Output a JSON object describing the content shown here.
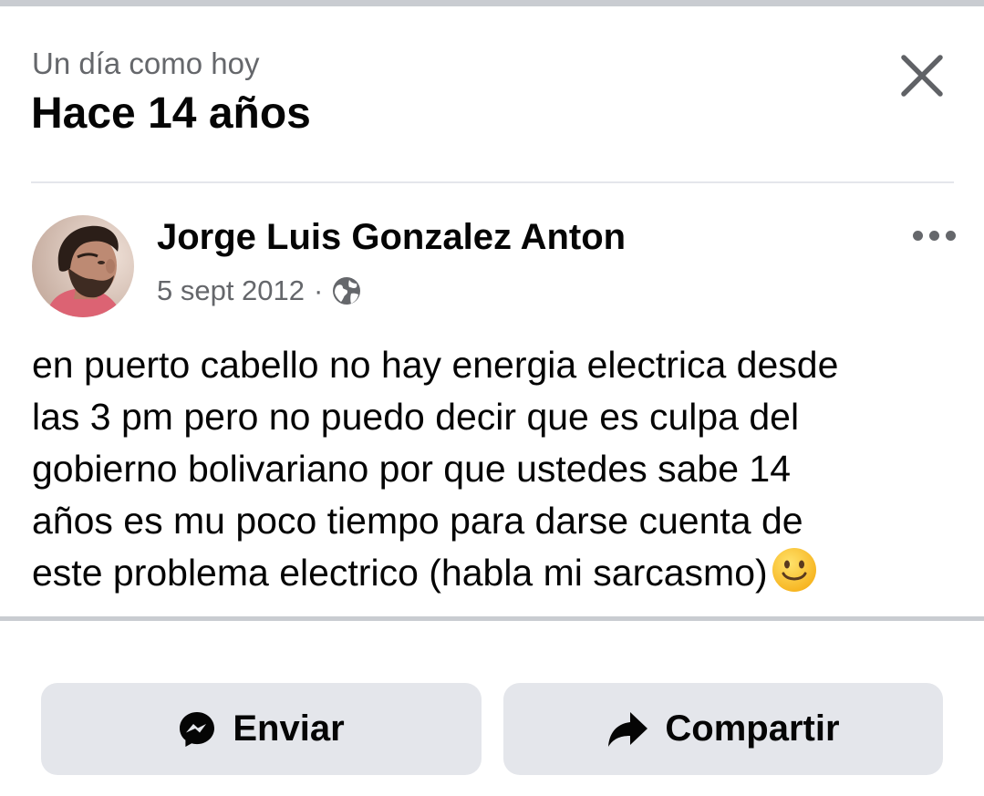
{
  "header": {
    "subtitle": "Un día como hoy",
    "title": "Hace 14 años",
    "close_icon": "close-icon"
  },
  "post": {
    "author": "Jorge Luis Gonzalez Anton",
    "date": "5 sept 2012",
    "separator": "·",
    "privacy_icon": "globe-icon",
    "more_icon": "more-options-icon",
    "text": "en puerto cabello no hay energia electrica desde\nlas 3 pm pero no puedo decir que es culpa del\ngobierno bolivariano por que ustedes sabe 14\naños es mu poco tiempo para darse cuenta de\neste problema electrico (habla mi sarcasmo)",
    "emoji": "slightly-smiling-face-emoji"
  },
  "actions": {
    "send_label": "Enviar",
    "send_icon": "messenger-icon",
    "share_label": "Compartir",
    "share_icon": "share-arrow-icon"
  },
  "colors": {
    "secondary_text": "#65676b",
    "button_bg": "#e4e6eb",
    "divider": "#c9ccd1"
  }
}
